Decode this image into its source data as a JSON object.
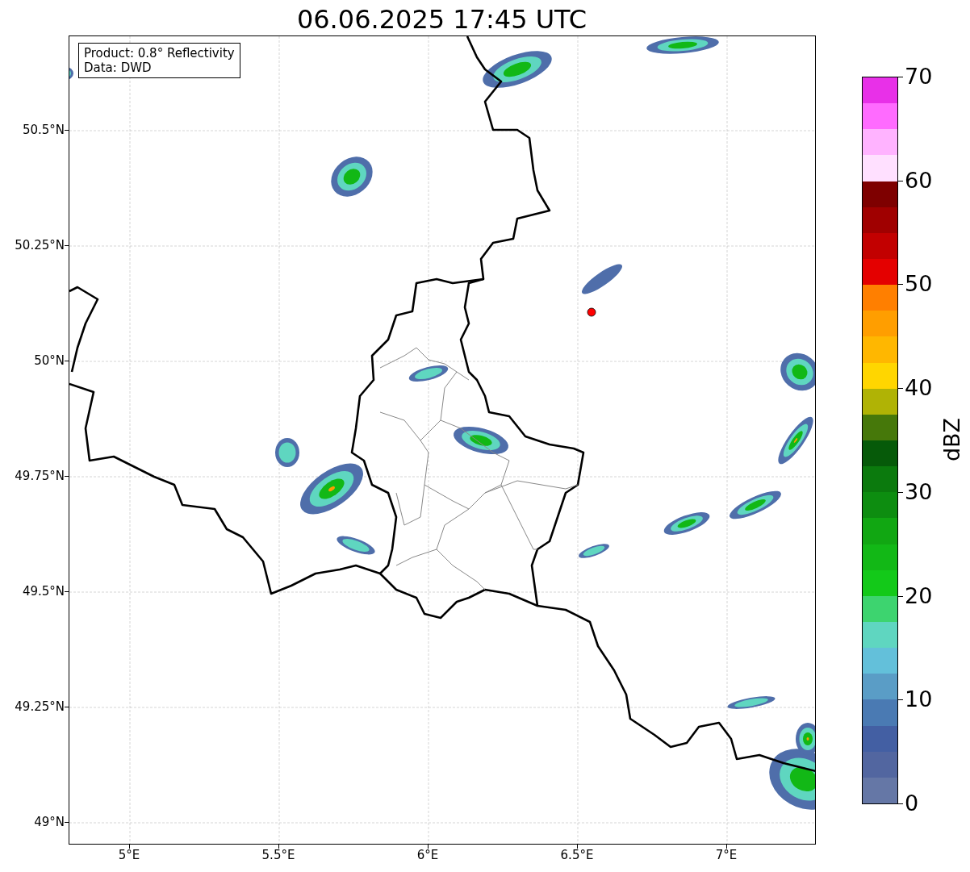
{
  "title": "06.06.2025 17:45 UTC",
  "info_box": {
    "lines": [
      "Product: 0.8° Reflectivity",
      "Data: DWD"
    ]
  },
  "map": {
    "y_axis_labels": [
      "50.5°N",
      "50.25°N",
      "50°N",
      "49.75°N",
      "49.5°N",
      "49.25°N",
      "49°N"
    ],
    "x_axis_labels": [
      "5°E",
      "5.5°E",
      "6°E",
      "6.5°E",
      "7°E"
    ]
  },
  "colorbar": {
    "label": "dBZ",
    "tick_labels": [
      "70",
      "60",
      "50",
      "40",
      "30",
      "20",
      "10",
      "0"
    ],
    "bands": [
      {
        "color": "#e830e8"
      },
      {
        "color": "#ff6bff"
      },
      {
        "color": "#ffb3ff"
      },
      {
        "color": "#ffe0ff"
      },
      {
        "color": "#7e0000"
      },
      {
        "color": "#a00000"
      },
      {
        "color": "#c20000"
      },
      {
        "color": "#e40000"
      },
      {
        "color": "#ff7f00"
      },
      {
        "color": "#ff9e00"
      },
      {
        "color": "#ffb700"
      },
      {
        "color": "#ffd600"
      },
      {
        "color": "#b0b305"
      },
      {
        "color": "#46780a"
      },
      {
        "color": "#065a09"
      },
      {
        "color": "#0b7a0d"
      },
      {
        "color": "#0d8d10"
      },
      {
        "color": "#11a712"
      },
      {
        "color": "#12b816"
      },
      {
        "color": "#13c919"
      },
      {
        "color": "#3dd46f"
      },
      {
        "color": "#5fd6c0"
      },
      {
        "color": "#63c0da"
      },
      {
        "color": "#5a9dc6"
      },
      {
        "color": "#4a7ab3"
      },
      {
        "color": "#435fa3"
      },
      {
        "color": "#5266a0"
      },
      {
        "color": "#6577a6"
      }
    ]
  }
}
